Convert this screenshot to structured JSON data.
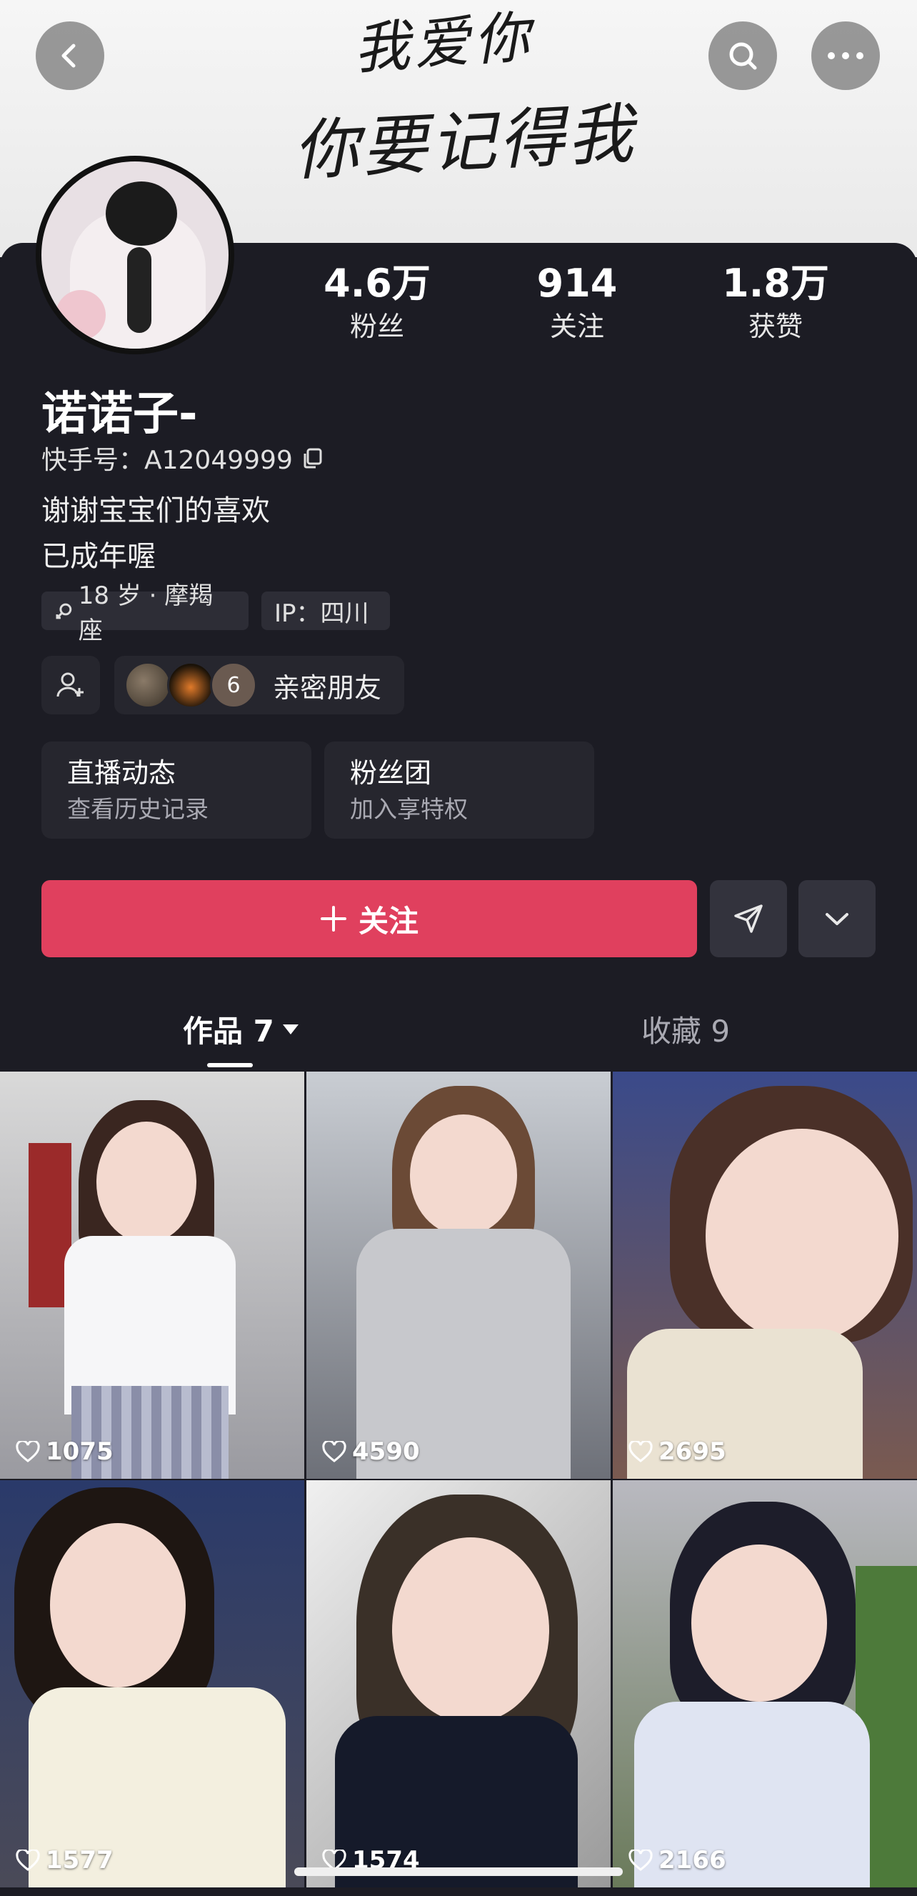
{
  "banner": {
    "line1": "我爱你",
    "line2": "你要记得我"
  },
  "profile": {
    "name": "诺诺子-",
    "kuaishou_id": "快手号：A12049999",
    "bio_line1": "谢谢宝宝们的喜欢",
    "bio_line2": "已成年喔",
    "tag_age": "18 岁 · 摩羯座",
    "tag_ip": "IP：四川"
  },
  "stats": [
    {
      "value": "4.6万",
      "label": "粉丝"
    },
    {
      "value": "914",
      "label": "关注"
    },
    {
      "value": "1.8万",
      "label": "获赞"
    }
  ],
  "friends": {
    "count": "6",
    "label": "亲密朋友"
  },
  "cards": [
    {
      "title": "直播动态",
      "subtitle": "查看历史记录"
    },
    {
      "title": "粉丝团",
      "subtitle": "加入享特权"
    }
  ],
  "actions": {
    "follow": "关注"
  },
  "tabs": [
    {
      "label": "作品 7"
    },
    {
      "label": "收藏 9"
    }
  ],
  "videos": [
    {
      "likes": "1075"
    },
    {
      "likes": "4590"
    },
    {
      "likes": "2695"
    },
    {
      "likes": "1577"
    },
    {
      "likes": "1574"
    },
    {
      "likes": "2166"
    }
  ],
  "colors": {
    "accent": "#e0405e",
    "background": "#1c1c24"
  }
}
